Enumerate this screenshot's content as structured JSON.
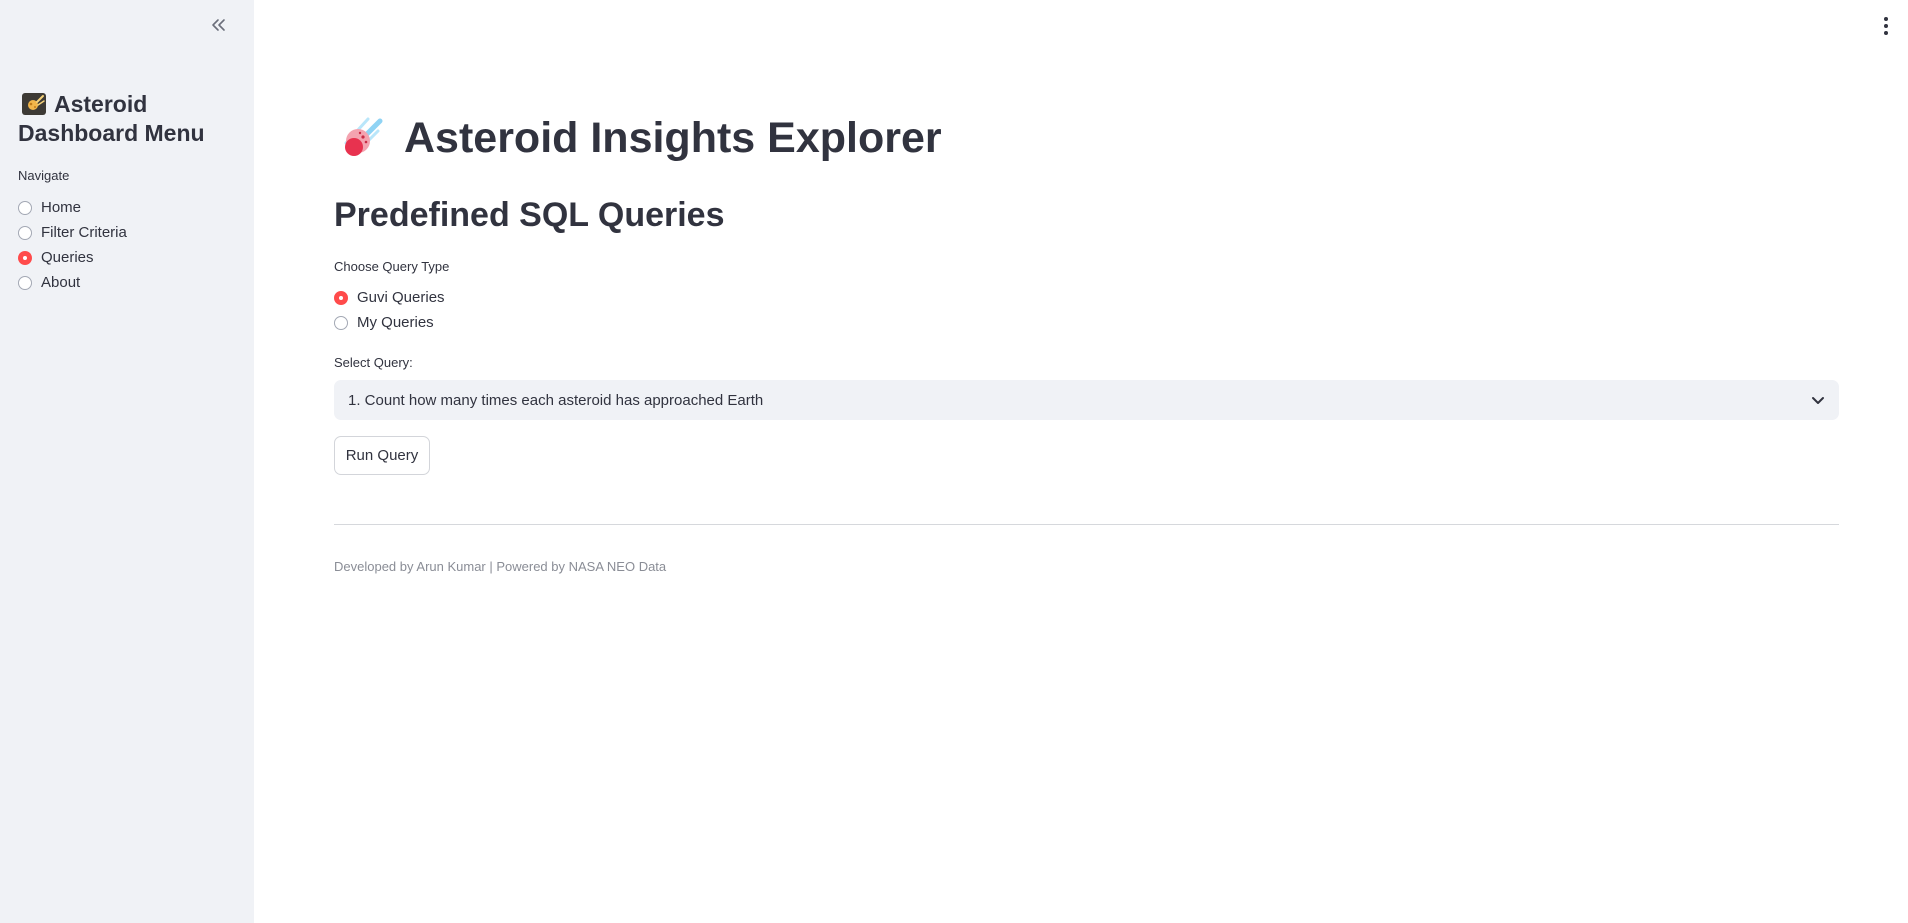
{
  "sidebar": {
    "title": "Asteroid Dashboard Menu",
    "title_icon": "comet-emoji-icon",
    "collapse_icon": "double-chevron-left-icon",
    "nav_label": "Navigate",
    "nav_items": [
      {
        "label": "Home",
        "selected": false
      },
      {
        "label": "Filter Criteria",
        "selected": false
      },
      {
        "label": "Queries",
        "selected": true
      },
      {
        "label": "About",
        "selected": false
      }
    ]
  },
  "header": {
    "menu_icon": "vertical-ellipsis-icon"
  },
  "main": {
    "title": "Asteroid Insights Explorer",
    "title_icon": "comet-icon",
    "section_heading": "Predefined SQL Queries",
    "query_type": {
      "label": "Choose Query Type",
      "options": [
        {
          "label": "Guvi Queries",
          "selected": true
        },
        {
          "label": "My Queries",
          "selected": false
        }
      ]
    },
    "select": {
      "label": "Select Query:",
      "value": "1. Count how many times each asteroid has approached Earth",
      "icon": "chevron-down-icon"
    },
    "run_button_label": "Run Query",
    "footer": "Developed by Arun Kumar | Powered by NASA NEO Data"
  },
  "colors": {
    "accent": "#ff4b4b",
    "sidebar_bg": "#f0f2f6",
    "text": "#31333f",
    "muted_text": "#8a8d96"
  }
}
